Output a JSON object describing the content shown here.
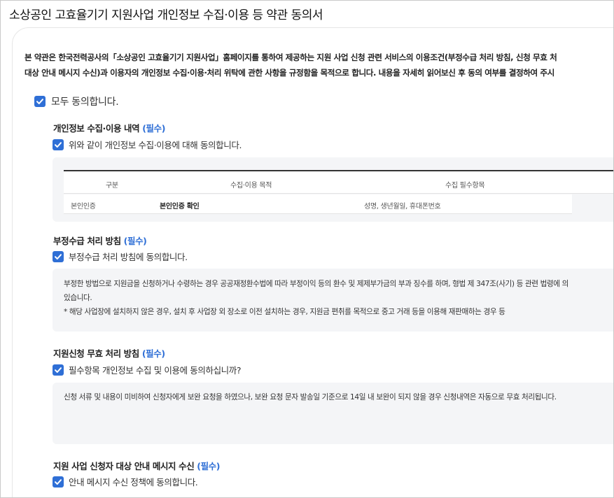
{
  "title": "소상공인 고효율기기 지원사업 개인정보 수집·이용 등 약관 동의서",
  "intro": {
    "line1": "본 약관은 한국전력공사의「소상공인 고효율기기 지원사업」홈페이지를 통하여 제공하는 지원 사업 신청 관련 서비스의 이용조건(부정수급 처리 방침, 신청 무효 처",
    "line2": "대상 안내 메시지 수신)과 이용자의 개인정보 수집·이용·처리 위탁에 관한 사항을 규정함을 목적으로 합니다. 내용을 자세히 읽어보신 후 동의 여부를 결정하여 주시"
  },
  "agree_all": {
    "label": "모두 동의합니다.",
    "checked": true
  },
  "required_tag": "(필수)",
  "sections": {
    "privacy": {
      "title": "개인정보 수집·이용 내역",
      "check_label": "위와 같이 개인정보 수집·이용에 대해 동의합니다.",
      "checked": true,
      "table": {
        "headers": [
          "구분",
          "수집·이용 목적",
          "수집 필수항목"
        ],
        "rows": [
          [
            "본인인증",
            "본인인증 확인",
            "성명, 생년월일, 휴대폰번호"
          ]
        ]
      }
    },
    "fraud": {
      "title": "부정수급 처리 방침",
      "check_label": "부정수급 처리 방침에 동의합니다.",
      "checked": true,
      "text": [
        "부정한 방법으로 지원금을 신청하거나 수령하는 경우 공공재정환수법에 따라 부정이익 등의 환수 및 제제부가금의 부과 징수를 하며, 형법 제 347조(사기) 등 관련 법령에 의",
        "있습니다.",
        "* 해당 사업장에 설치하지 않은 경우, 설치 후 사업장 외 장소로 이전 설치하는 경우, 지원금 편취를 목적으로 중고 거래 등을 이용해 재판매하는 경우 등"
      ]
    },
    "invalid": {
      "title": "지원신청 무효 처리 방침",
      "check_label": "필수항목 개인정보 수집 및 이용에 동의하십니까?",
      "checked": true,
      "text": [
        "신청 서류 및 내용이 미비하여 신청자에게 보완 요청을 하였으나, 보완 요청 문자 발송일 기준으로 14일 내 보완이 되지 않을 경우 신청내역은 자동으로 무효 처리됩니다."
      ]
    },
    "message": {
      "title": "지원 사업 신청자 대상 안내 메시지 수신",
      "check_label": "안내 메시지 수신 정책에 동의합니다.",
      "checked": true
    }
  },
  "colors": {
    "accent": "#2f6fd6",
    "panel_bg": "#f4f5f7"
  }
}
